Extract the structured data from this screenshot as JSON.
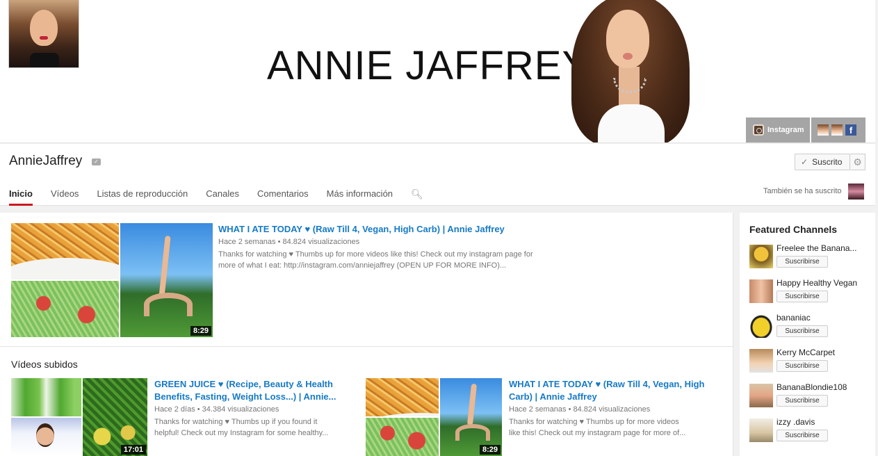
{
  "banner": {
    "title": "ANNIE JAFFREY",
    "links": {
      "instagram_label": "Instagram"
    }
  },
  "header": {
    "channel_name": "AnnieJaffrey",
    "subscribed_label": "Suscrito",
    "also_subscribed_label": "También se ha suscrito",
    "tabs": [
      {
        "label": "Inicio",
        "active": true
      },
      {
        "label": "Vídeos"
      },
      {
        "label": "Listas de reproducción"
      },
      {
        "label": "Canales"
      },
      {
        "label": "Comentarios"
      },
      {
        "label": "Más información"
      }
    ]
  },
  "featured_video": {
    "title": "WHAT I ATE TODAY ♥ (Raw Till 4, Vegan, High Carb) | Annie Jaffrey",
    "age": "Hace 2 semanas",
    "views": "84.824 visualizaciones",
    "description_line1": "Thanks for watching ♥ Thumbs up for more videos like this! Check out my instagram page for",
    "description_line2": "more of what I eat: http://instagram.com/anniejaffrey (OPEN UP FOR MORE INFO)...",
    "duration": "8:29"
  },
  "uploads": {
    "section_title": "Vídeos subidos",
    "items": [
      {
        "title_line1": "GREEN JUICE ♥ (Recipe, Beauty & Health",
        "title_line2": "Benefits, Fasting, Weight Loss...) | Annie...",
        "age": "Hace 2 días",
        "views": "34.384 visualizaciones",
        "desc_line1": "Thanks for watching ♥ Thumbs up if you found it",
        "desc_line2": "helpful! Check out my Instagram for some healthy...",
        "duration": "17:01"
      },
      {
        "title_line1": "WHAT I ATE TODAY ♥ (Raw Till 4, Vegan, High",
        "title_line2": "Carb) | Annie Jaffrey",
        "age": "Hace 2 semanas",
        "views": "84.824 visualizaciones",
        "desc_line1": "Thanks for watching ♥ Thumbs up for more videos",
        "desc_line2": "like this! Check out my instagram page for more of...",
        "duration": "8:29"
      }
    ]
  },
  "sidebar": {
    "title": "Featured Channels",
    "subscribe_label": "Suscribirse",
    "channels": [
      {
        "name": "Freelee the Banana..."
      },
      {
        "name": "Happy Healthy Vegan"
      },
      {
        "name": "bananiac"
      },
      {
        "name": "Kerry McCarpet"
      },
      {
        "name": "BananaBlondie108"
      },
      {
        "name": "izzy .davis"
      }
    ]
  },
  "colors": {
    "link_blue": "#167ac6",
    "active_tab_red": "#cc181e",
    "facebook_blue": "#3b5998"
  }
}
